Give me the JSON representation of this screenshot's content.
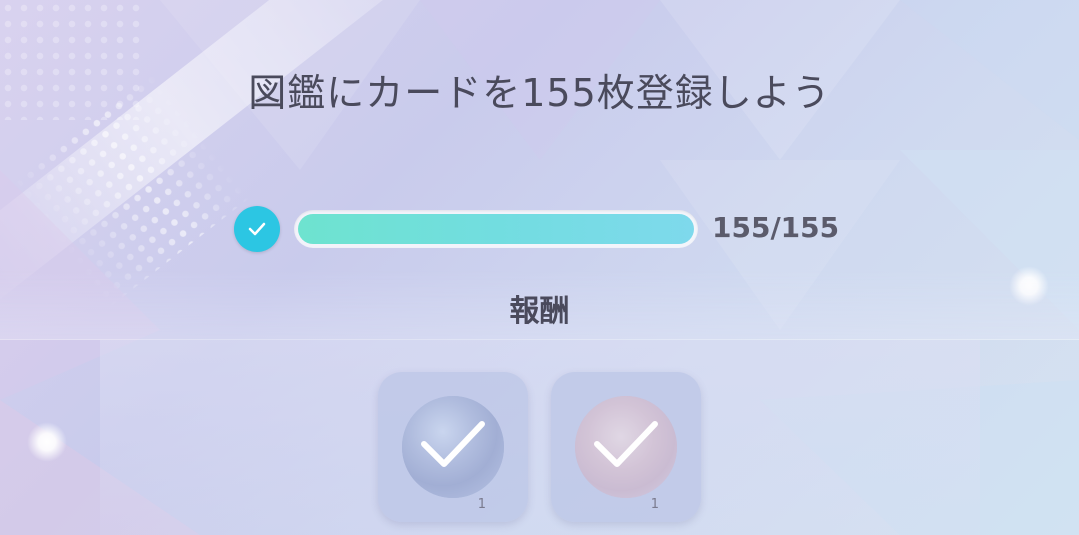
{
  "mission": {
    "title": "図鑑にカードを155枚登録しよう",
    "progress": {
      "current": 155,
      "total": 155,
      "fraction": 1.0,
      "label": "155/155",
      "completed": true
    }
  },
  "rewards": {
    "header": "報酬",
    "items": [
      {
        "quantity": "1",
        "claimed": true,
        "icon": "card-reward-icon"
      },
      {
        "quantity": "1",
        "claimed": true,
        "icon": "card-reward-icon"
      }
    ]
  },
  "colors": {
    "check_circle": "#2cc6e3",
    "progress_fill_start": "#6ee3cf",
    "progress_fill_end": "#7ed9ec",
    "text": "#4a4a5c"
  }
}
